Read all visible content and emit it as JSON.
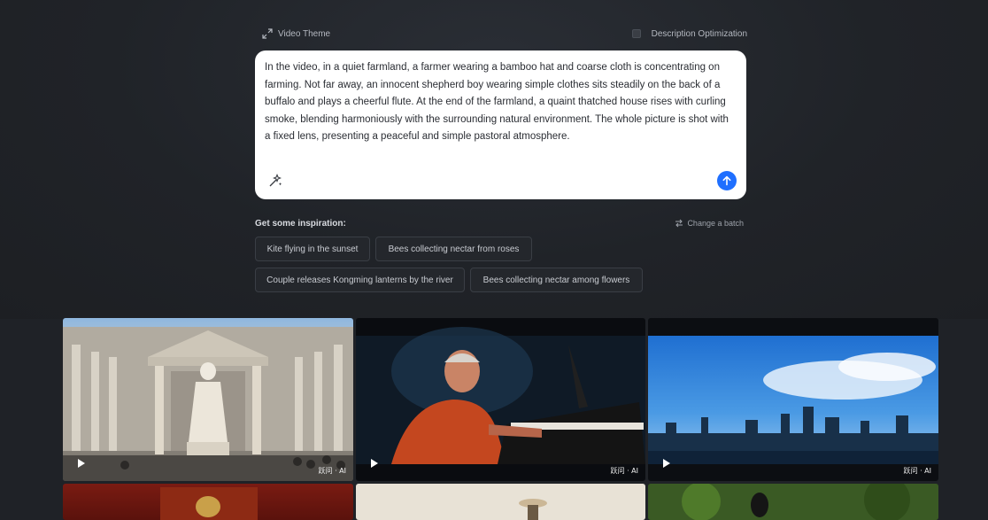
{
  "header": {
    "video_theme_label": "Video Theme",
    "description_optimization_label": "Description Optimization"
  },
  "prompt": {
    "text": "In the video, in a quiet farmland, a farmer wearing a bamboo hat and coarse cloth is concentrating on farming. Not far away, an innocent shepherd boy wearing simple clothes sits steadily on the back of a buffalo and plays a cheerful flute. At the end of the farmland, a quaint thatched house rises with curling smoke, blending harmoniously with the surrounding natural environment. The whole picture is shot with a fixed lens, presenting a peaceful and simple pastoral atmosphere."
  },
  "inspiration": {
    "title": "Get some inspiration:",
    "change_batch_label": "Change a batch",
    "chips": [
      "Kite flying in the sunset",
      "Bees collecting nectar from roses",
      "Couple releases Kongming lanterns by the river",
      "Bees collecting nectar among flowers"
    ]
  },
  "gallery": {
    "watermark": "跃问 · AI",
    "accent_color": "#1f6fff"
  }
}
